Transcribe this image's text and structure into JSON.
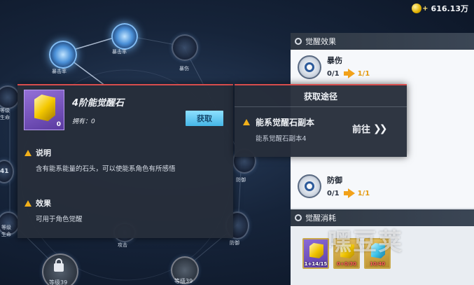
{
  "currency": {
    "amount": "616.13万",
    "plus": "+"
  },
  "skill_tree": {
    "nodes": [
      {
        "label": "暴击率"
      },
      {
        "label": "暴击率"
      },
      {
        "label": "暴伤"
      },
      {
        "label": "等级\n生命"
      },
      {
        "label": "41"
      },
      {
        "label": "防御"
      },
      {
        "label": "等级\n生命"
      },
      {
        "label": "攻击"
      },
      {
        "label": "防御"
      },
      {
        "label": "等级39"
      },
      {
        "label": "等级39"
      }
    ]
  },
  "right_panel": {
    "awaken_effect_title": "觉醒效果",
    "effects": [
      {
        "name": "暴伤",
        "current": "0/1",
        "next": "1/1"
      },
      {
        "name": "防御",
        "current": "0/1",
        "next": "1/1"
      }
    ],
    "awaken_cost_title": "觉醒消耗",
    "cost_items": [
      {
        "qty": "1+14/15",
        "color": "purple",
        "insufficient": false
      },
      {
        "qty": "0+0/30",
        "color": "gold",
        "insufficient": true
      },
      {
        "qty": "10/40",
        "color": "gold",
        "insufficient": true
      }
    ]
  },
  "item_tooltip": {
    "title": "4阶能觉醒石",
    "owned": "拥有：0",
    "count": "0",
    "acquire_label": "获取",
    "desc_title": "说明",
    "desc_text": "含有能系能量的石头，可以使能系角色有所感悟",
    "effect_title": "效果",
    "effect_text": "可用于角色觉醒"
  },
  "acquire_popup": {
    "title": "获取途径",
    "path_name": "能系觉醒石副本",
    "path_sub": "能系觉醒石副本4",
    "goto_label": "前往"
  },
  "watermark": "嘿豆荚",
  "colors": {
    "accent_red": "#d84d4d",
    "acquire_button": "#45b6e6",
    "progress_new": "#e49a10"
  }
}
